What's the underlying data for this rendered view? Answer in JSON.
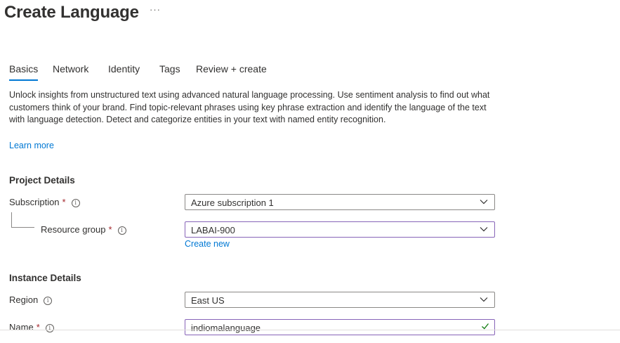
{
  "header": {
    "title": "Create Language",
    "more_label": "···"
  },
  "tabs": [
    {
      "label": "Basics",
      "active": true
    },
    {
      "label": "Network",
      "active": false
    },
    {
      "label": "Identity",
      "active": false
    },
    {
      "label": "Tags",
      "active": false
    },
    {
      "label": "Review + create",
      "active": false
    }
  ],
  "description": "Unlock insights from unstructured text using advanced natural language processing. Use sentiment analysis to find out what customers think of your brand. Find topic-relevant phrases using key phrase extraction and identify the language of the text with language detection. Detect and categorize entities in your text with named entity recognition.",
  "learn_more": "Learn more",
  "project_details": {
    "heading": "Project Details",
    "subscription": {
      "label": "Subscription",
      "required_mark": "*",
      "value": "Azure subscription 1"
    },
    "resource_group": {
      "label": "Resource group",
      "required_mark": "*",
      "value": "LABAI-900",
      "create_new": "Create new"
    }
  },
  "instance_details": {
    "heading": "Instance Details",
    "region": {
      "label": "Region",
      "value": "East US"
    },
    "name": {
      "label": "Name",
      "required_mark": "*",
      "value": "indiomalanguage"
    }
  },
  "colors": {
    "accent": "#0078d4",
    "focus_border": "#8764b8",
    "required": "#a4262c",
    "valid_check": "#107c10"
  },
  "icons": [
    "info-icon",
    "chevron-down-icon",
    "checkmark-icon"
  ]
}
